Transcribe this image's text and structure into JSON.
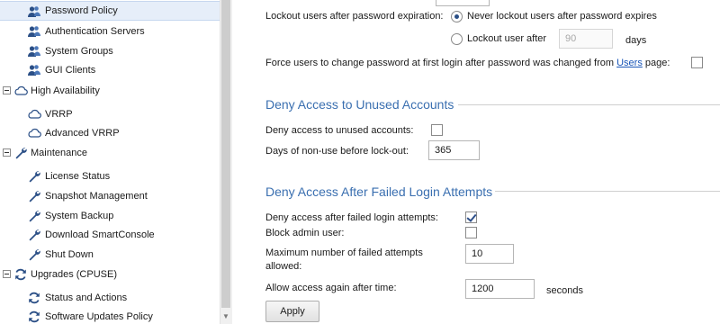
{
  "sidebar": {
    "items": [
      {
        "label": "Password Policy",
        "icon": "users-icon"
      },
      {
        "label": "Authentication Servers",
        "icon": "users-icon"
      },
      {
        "label": "System Groups",
        "icon": "users-icon"
      },
      {
        "label": "GUI Clients",
        "icon": "users-icon"
      },
      {
        "label": "High Availability",
        "icon": "cloud-icon"
      },
      {
        "label": "VRRP",
        "icon": "cloud-icon"
      },
      {
        "label": "Advanced VRRP",
        "icon": "cloud-icon"
      },
      {
        "label": "Maintenance",
        "icon": "wrench-icon"
      },
      {
        "label": "License Status",
        "icon": "wrench-icon"
      },
      {
        "label": "Snapshot Management",
        "icon": "wrench-icon"
      },
      {
        "label": "System Backup",
        "icon": "wrench-icon"
      },
      {
        "label": "Download SmartConsole",
        "icon": "wrench-icon"
      },
      {
        "label": "Shut Down",
        "icon": "wrench-icon"
      },
      {
        "label": "Upgrades (CPUSE)",
        "icon": "refresh-icon"
      },
      {
        "label": "Status and Actions",
        "icon": "refresh-icon"
      },
      {
        "label": "Software Updates Policy",
        "icon": "refresh-icon"
      }
    ]
  },
  "expiration": {
    "lockout_label": "Lockout users after password expiration:",
    "never_label": "Never lockout users after password expires",
    "lockout_after_label": "Lockout user after",
    "lockout_after_value": "90",
    "days_label": "days",
    "force_change_prefix": "Force users to change password at first login after password was changed from",
    "force_change_link": "Users",
    "force_change_suffix": "page:",
    "force_change_checked": false
  },
  "unused": {
    "title": "Deny Access to Unused Accounts",
    "deny_label": "Deny access to unused accounts:",
    "deny_checked": false,
    "days_label": "Days of non-use before lock-out:",
    "days_value": "365"
  },
  "failed": {
    "title": "Deny Access After Failed Login Attempts",
    "deny_label": "Deny access after failed login attempts:",
    "deny_checked": true,
    "block_admin_label": "Block admin user:",
    "block_admin_checked": false,
    "max_label_line1": "Maximum number of failed attempts",
    "max_label_line2": "allowed:",
    "max_value": "10",
    "allow_label": "Allow access again after time:",
    "allow_value": "1200",
    "seconds_label": "seconds"
  },
  "apply_label": "Apply",
  "colors": {
    "section_title": "#3a6fb0",
    "link": "#1a56b8",
    "selected_row": "#e6eef9"
  }
}
